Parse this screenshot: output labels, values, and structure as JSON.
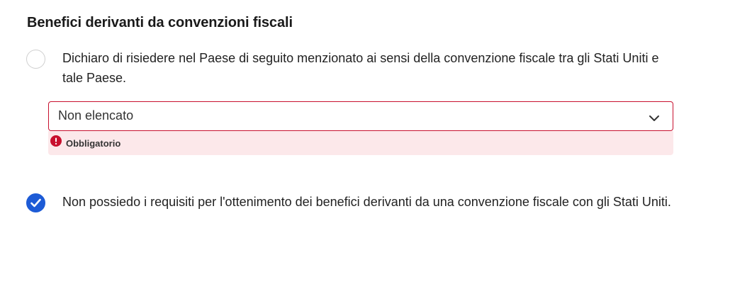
{
  "section": {
    "title": "Benefici derivanti da convenzioni fiscali"
  },
  "options": [
    {
      "text": "Dichiaro di risiedere nel Paese di seguito menzionato ai sensi della convenzione fiscale tra gli Stati Uniti e tale Paese.",
      "checked": false
    },
    {
      "text": "Non possiedo i requisiti per l'ottenimento dei benefici derivanti da una convenzione fiscale con gli Stati Uniti.",
      "checked": true
    }
  ],
  "country_select": {
    "value": "Non elencato",
    "error": "Obbligatorio"
  },
  "colors": {
    "accent": "#1d5bd6",
    "error": "#c8102e",
    "error_background": "#fce8ea"
  },
  "icons": {
    "radio_checked": "checkmark-icon",
    "select": "chevron-down-icon",
    "error": "error-icon"
  }
}
